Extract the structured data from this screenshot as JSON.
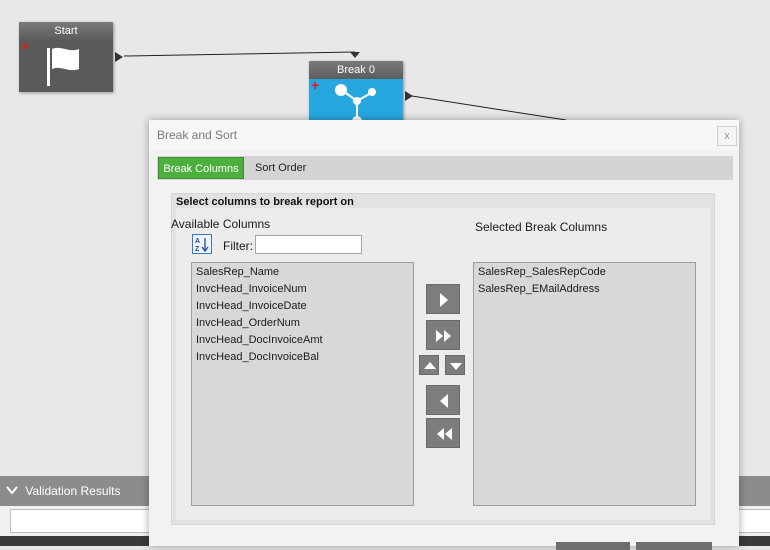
{
  "workflow": {
    "start_node": {
      "title": "Start",
      "icon": "flag-icon"
    },
    "break_node": {
      "title": "Break 0",
      "icon": "branch-icon"
    }
  },
  "validation": {
    "title": "Validation Results",
    "input_value": ""
  },
  "dialog": {
    "title": "Break and Sort",
    "close_label": "x",
    "tabs": [
      {
        "label": "Break Columns",
        "active": true
      },
      {
        "label": "Sort Order",
        "active": false
      }
    ],
    "group_title": "Select columns to break report on",
    "available": {
      "label": "Available Columns",
      "filter_label": "Filter:",
      "filter_value": "",
      "items": [
        "SalesRep_Name",
        "InvcHead_InvoiceNum",
        "InvcHead_InvoiceDate",
        "InvcHead_OrderNum",
        "InvcHead_DocInvoiceAmt",
        "InvcHead_DocInvoiceBal"
      ]
    },
    "selected": {
      "label": "Selected Break Columns",
      "items": [
        "SalesRep_SalesRepCode",
        "SalesRep_EMailAddress"
      ]
    }
  },
  "colors": {
    "accent_green": "#4caf3e",
    "node_blue": "#27a7e0",
    "node_gray": "#5a5a5a",
    "button_gray": "#7d7d7d"
  }
}
